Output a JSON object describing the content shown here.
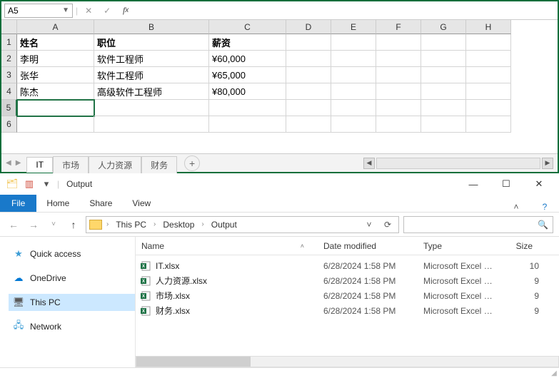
{
  "excel": {
    "name_box": "A5",
    "col_headers": [
      "A",
      "B",
      "C",
      "D",
      "E",
      "F",
      "G",
      "H"
    ],
    "row_headers": [
      "1",
      "2",
      "3",
      "4",
      "5",
      "6"
    ],
    "selected_row": 5,
    "header_row": {
      "name": "姓名",
      "title": "职位",
      "salary": "薪资"
    },
    "rows": [
      {
        "name": "李明",
        "title": "软件工程师",
        "salary": "¥60,000"
      },
      {
        "name": "张华",
        "title": "软件工程师",
        "salary": "¥65,000"
      },
      {
        "name": "陈杰",
        "title": "高级软件工程师",
        "salary": "¥80,000"
      }
    ],
    "tabs": [
      "IT",
      "市场",
      "人力资源",
      "财务"
    ],
    "active_tab": "IT"
  },
  "explorer": {
    "title": "Output",
    "ribbon": {
      "file": "File",
      "home": "Home",
      "share": "Share",
      "view": "View"
    },
    "breadcrumbs": [
      "This PC",
      "Desktop",
      "Output"
    ],
    "nav": {
      "quick_access": "Quick access",
      "onedrive": "OneDrive",
      "this_pc": "This PC",
      "network": "Network"
    },
    "columns": {
      "name": "Name",
      "date": "Date modified",
      "type": "Type",
      "size": "Size"
    },
    "files": [
      {
        "name": "IT.xlsx",
        "date": "6/28/2024 1:58 PM",
        "type": "Microsoft Excel W...",
        "size": "10"
      },
      {
        "name": "人力资源.xlsx",
        "date": "6/28/2024 1:58 PM",
        "type": "Microsoft Excel W...",
        "size": "9"
      },
      {
        "name": "市场.xlsx",
        "date": "6/28/2024 1:58 PM",
        "type": "Microsoft Excel W...",
        "size": "9"
      },
      {
        "name": "财务.xlsx",
        "date": "6/28/2024 1:58 PM",
        "type": "Microsoft Excel W...",
        "size": "9"
      }
    ]
  },
  "chart_data": {
    "type": "table",
    "columns": [
      "姓名",
      "职位",
      "薪资"
    ],
    "rows": [
      [
        "李明",
        "软件工程师",
        "¥60,000"
      ],
      [
        "张华",
        "软件工程师",
        "¥65,000"
      ],
      [
        "陈杰",
        "高级软件工程师",
        "¥80,000"
      ]
    ]
  }
}
